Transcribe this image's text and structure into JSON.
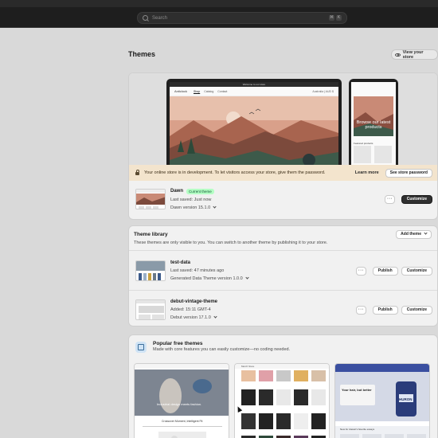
{
  "topbar": {
    "search_placeholder": "Search",
    "shortcut_keys": [
      "⌘",
      "K"
    ]
  },
  "page": {
    "title": "Themes",
    "view_store_label": "View your store"
  },
  "current_theme": {
    "preview": {
      "laptop_announcement": "Welcome to our store",
      "laptop_brand": "Anticlock",
      "laptop_nav": [
        "Shop",
        "Catalog",
        "Contact"
      ],
      "laptop_nav_right": "Australia | AUD $",
      "phone_hero_text": "Browse our latest products",
      "phone_featured_label": "Featured products"
    },
    "banner": {
      "message": "Your online store is in development. To let visitors access your store, give them the password.",
      "learn_more": "Learn more",
      "password_button": "See store password"
    },
    "name": "Dawn",
    "badge": "Current theme",
    "last_saved": "Last saved: Just now",
    "version": "Dawn version 15.1.0",
    "more_button": "···",
    "customize_button": "Customize"
  },
  "library": {
    "title": "Theme library",
    "subtitle": "These themes are only visible to you. You can switch to another theme by publishing it to your store.",
    "add_theme": "Add theme",
    "themes": [
      {
        "name": "test-data",
        "saved": "Last saved: 47 minutes ago",
        "version": "Generated Data Theme version 1.0.0",
        "more": "···",
        "publish": "Publish",
        "customize": "Customize"
      },
      {
        "name": "debut-vintage-theme",
        "saved": "Added: 15:11 GMT-4",
        "version": "Debut version 17.1.0",
        "more": "···",
        "publish": "Publish",
        "customize": "Customize"
      }
    ]
  },
  "popular": {
    "title": "Popular free themes",
    "subtitle": "Made with core features you can easily customize—no coding needed.",
    "previews": [
      {
        "caption": "Industrial design meets fashion.",
        "sub": "Crossover Moment, Intelligent Fit"
      },
      {
        "caption": "Merch Store"
      },
      {
        "caption": "Your hair, but better",
        "brand": "HURON",
        "strip": "New for classic's favorite essays"
      }
    ]
  },
  "colors": {
    "topbar": "#1e1e1e",
    "page_bg": "#d9d9d9",
    "card_bg": "#f1f1f1",
    "banner_bg": "#f3e4cd",
    "badge_bg": "#b4fec4",
    "primary_button": "#303030"
  }
}
